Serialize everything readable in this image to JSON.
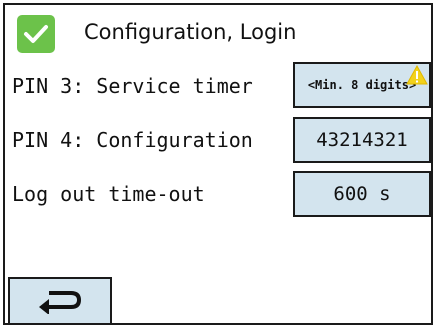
{
  "header": {
    "title": "Configuration, Login",
    "status_icon": "check-icon",
    "status_color": "#6cc24a"
  },
  "rows": [
    {
      "label": "PIN 3: Service timer",
      "value": "<Min. 8 digits>",
      "warning_icon": "warning-icon",
      "warning_color": "#f2d21b"
    },
    {
      "label": "PIN 4: Configuration",
      "value": "43214321"
    },
    {
      "label": "Log out time-out",
      "value": "600 s"
    }
  ],
  "footer": {
    "back_icon": "return-arrow-icon"
  },
  "colors": {
    "field_background": "#d3e4ee",
    "border": "#1a1a1a"
  }
}
